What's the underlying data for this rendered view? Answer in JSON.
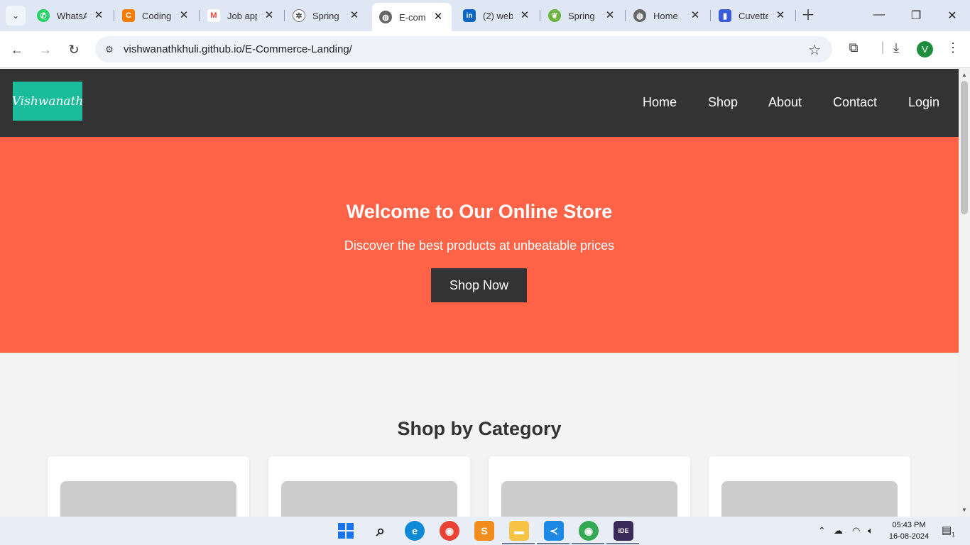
{
  "browser": {
    "tabs": [
      {
        "title": "WhatsApp",
        "icon": "whatsapp-icon",
        "color": "#25d366"
      },
      {
        "title": "Coding",
        "icon": "coding-icon",
        "color": "#f57c00"
      },
      {
        "title": "Job app",
        "icon": "gmail-icon",
        "color": "#ea4335"
      },
      {
        "title": "Spring",
        "icon": "chatgpt-icon",
        "color": "#555555"
      },
      {
        "title": "E-com",
        "icon": "globe-icon",
        "color": "#555555",
        "active": true
      },
      {
        "title": "(2) web",
        "icon": "linkedin-icon",
        "color": "#0a66c2"
      },
      {
        "title": "Spring",
        "icon": "spring-icon",
        "color": "#6db33f"
      },
      {
        "title": "Home",
        "icon": "globe-icon",
        "color": "#555555"
      },
      {
        "title": "Cuvette",
        "icon": "cuvette-icon",
        "color": "#3b5bdb"
      }
    ],
    "url": "vishwanathkhuli.github.io/E-Commerce-Landing/",
    "profile_initial": "V"
  },
  "site": {
    "logo_text": "Vishwanath",
    "nav": [
      "Home",
      "Shop",
      "About",
      "Contact",
      "Login"
    ],
    "hero": {
      "title": "Welcome to Our Online Store",
      "subtitle": "Discover the best products at unbeatable prices",
      "button": "Shop Now"
    },
    "section_title": "Shop by Category",
    "colors": {
      "header": "#333333",
      "hero": "#ff6347",
      "logo": "#1abc9c"
    }
  },
  "taskbar": {
    "apps": [
      "windows-start-icon",
      "search-icon",
      "edge-icon",
      "chrome-icon",
      "sublime-icon",
      "file-explorer-icon",
      "vscode-icon",
      "chrome-profile-icon",
      "ide-icon"
    ],
    "time": "05:43 PM",
    "date": "16-08-2024",
    "notifications": "1"
  }
}
